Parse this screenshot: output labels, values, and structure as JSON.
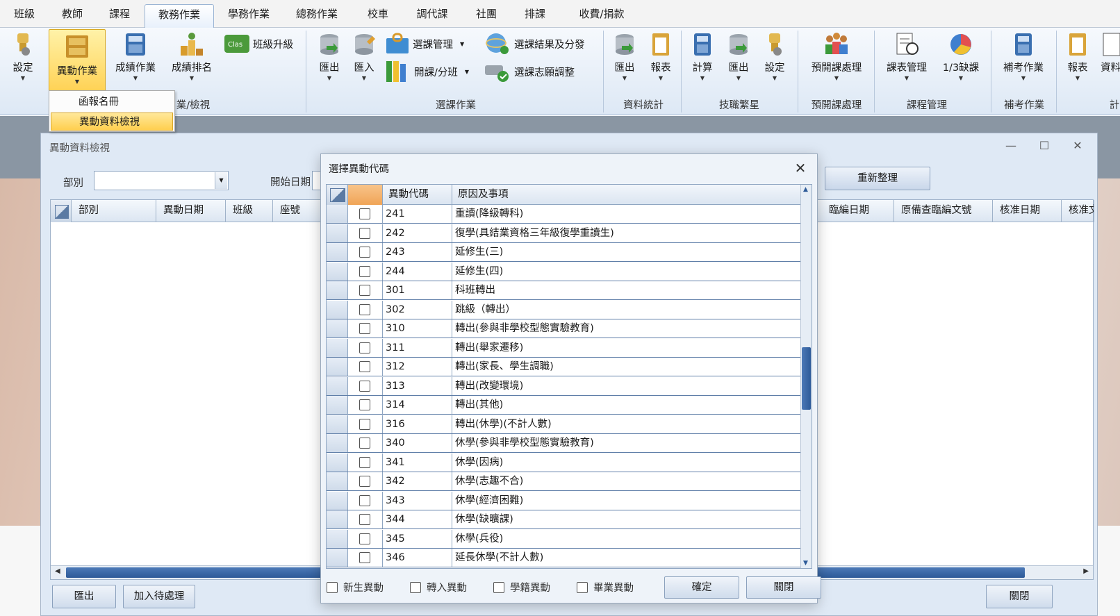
{
  "menubar": {
    "tabs": [
      "班級",
      "教師",
      "課程",
      "教務作業",
      "學務作業",
      "總務作業",
      "校車",
      "調代課",
      "社團",
      "排課",
      "收費/捐款"
    ],
    "active_index": 3
  },
  "ribbon": {
    "buttons": {
      "settings": "設定",
      "change_ops": "異動作業",
      "grade_ops": "成績作業",
      "grade_rank": "成績排名",
      "class_promote": "班級升級",
      "export1": "匯出",
      "import1": "匯入",
      "course_select_mgmt": "選課管理",
      "open_class_split": "開課/分班",
      "result_publish": "選課結果及分發",
      "preference_adjust": "選課志願調整",
      "export2": "匯出",
      "report1": "報表",
      "calculate": "計算",
      "export3": "匯出",
      "settings2": "設定",
      "preopen_process": "預開課處理",
      "schedule_mgmt": "課表管理",
      "absence_third": "1/3缺課",
      "makeup_exam": "補考作業",
      "report2": "報表",
      "data_cut": "資料"
    },
    "groups": {
      "grade_view": "業/檢視",
      "course_select": "選課作業",
      "data_stats": "資料統計",
      "tech_star": "技職繁星",
      "preopen": "預開課處理",
      "course_mgmt": "課程管理",
      "makeup": "補考作業",
      "cut_last": "計"
    }
  },
  "dropdown": {
    "items": [
      "函報名冊",
      "異動資料檢視"
    ],
    "highlight_index": 1
  },
  "main_window": {
    "title": "異動資料檢視",
    "department_label": "部別",
    "department_value": "",
    "start_date_label": "開始日期",
    "refresh_button": "重新整理",
    "columns_left": [
      "部別",
      "異動日期",
      "班級",
      "座號"
    ],
    "columns_right": [
      "臨編日期",
      "原備查臨編文號",
      "核准日期",
      "核准文號"
    ],
    "export_button": "匯出",
    "add_pending_button": "加入待處理",
    "close_button": "關閉"
  },
  "dialog": {
    "title": "選擇異動代碼",
    "col_code": "異動代碼",
    "col_reason": "原因及事項",
    "rows": [
      {
        "code": "241",
        "reason": "重讀(降級轉科)"
      },
      {
        "code": "242",
        "reason": "復學(具結業資格三年級復學重讀生)"
      },
      {
        "code": "243",
        "reason": "延修生(三)"
      },
      {
        "code": "244",
        "reason": "延修生(四)"
      },
      {
        "code": "301",
        "reason": "科班轉出"
      },
      {
        "code": "302",
        "reason": "跳級（轉出）"
      },
      {
        "code": "310",
        "reason": "轉出(參與非學校型態實驗教育)"
      },
      {
        "code": "311",
        "reason": "轉出(舉家遷移)"
      },
      {
        "code": "312",
        "reason": "轉出(家長、學生調職)"
      },
      {
        "code": "313",
        "reason": "轉出(改變環境)"
      },
      {
        "code": "314",
        "reason": "轉出(其他)"
      },
      {
        "code": "316",
        "reason": "轉出(休學)(不計人數)"
      },
      {
        "code": "340",
        "reason": "休學(參與非學校型態實驗教育)"
      },
      {
        "code": "341",
        "reason": "休學(因病)"
      },
      {
        "code": "342",
        "reason": "休學(志趣不合)"
      },
      {
        "code": "343",
        "reason": "休學(經濟困難)"
      },
      {
        "code": "344",
        "reason": "休學(缺曠課)"
      },
      {
        "code": "345",
        "reason": "休學(兵役)"
      },
      {
        "code": "346",
        "reason": "延長休學(不計人數)"
      }
    ],
    "filters": [
      "新生異動",
      "轉入異動",
      "學籍異動",
      "畢業異動"
    ],
    "ok_button": "確定",
    "close_button": "關閉"
  },
  "colors": {
    "accent": "#2d5a98",
    "highlight": "#ffd255",
    "orange_header": "#f0a457"
  }
}
